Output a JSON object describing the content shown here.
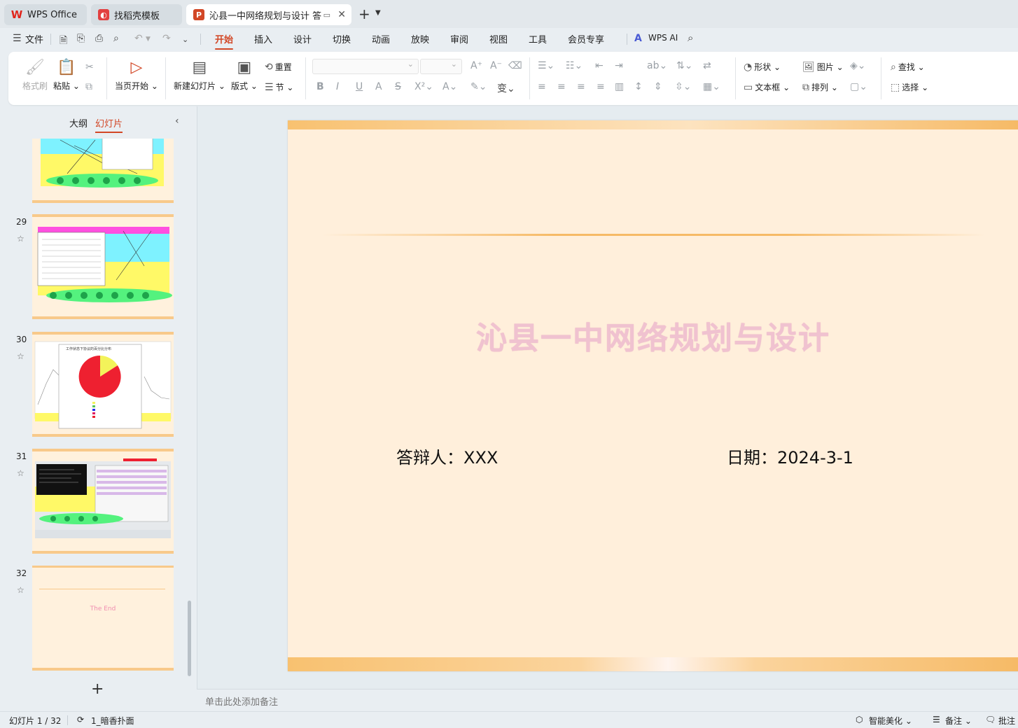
{
  "tabs": [
    {
      "label": "WPS Office",
      "icon": "wps-logo-icon"
    },
    {
      "label": "找稻壳模板",
      "icon": "docer-icon"
    },
    {
      "label": "沁县一中网络规划与设计 答辩",
      "icon": "presentation-icon"
    }
  ],
  "menu": {
    "file": "文件",
    "items": [
      "开始",
      "插入",
      "设计",
      "切换",
      "动画",
      "放映",
      "审阅",
      "视图",
      "工具",
      "会员专享"
    ],
    "active": "开始",
    "ai": "WPS AI"
  },
  "ribbon": {
    "format_painter": "格式刷",
    "paste": "粘贴",
    "play_from_current": "当页开始",
    "new_slide": "新建幻灯片",
    "layout": "版式",
    "reset": "重置",
    "section": "节",
    "shape": "形状",
    "picture": "图片",
    "find": "查找",
    "textbox": "文本框",
    "arrange": "排列",
    "select": "选择"
  },
  "left_panel": {
    "outline_tab": "大纲",
    "slides_tab": "幻灯片",
    "slides": [
      {
        "num": ""
      },
      {
        "num": "29"
      },
      {
        "num": "30"
      },
      {
        "num": "31"
      },
      {
        "num": "32",
        "text": "The End"
      }
    ],
    "pie_title": "工作状态下协议的百分比分布"
  },
  "slide": {
    "title": "沁县一中网络规划与设计",
    "presenter": "答辩人：XXX",
    "date": "日期：2024-3-1"
  },
  "notes_placeholder": "单击此处添加备注",
  "status": {
    "slide_counter": "幻灯片 1 / 32",
    "theme": "1_暗香扑面",
    "beautify": "智能美化",
    "notes": "备注",
    "comments": "批注"
  },
  "colors": {
    "accent": "#d24726",
    "slide_bg": "#ffefdb",
    "title_color": "#f0c2d0",
    "band": "#f8c170"
  }
}
